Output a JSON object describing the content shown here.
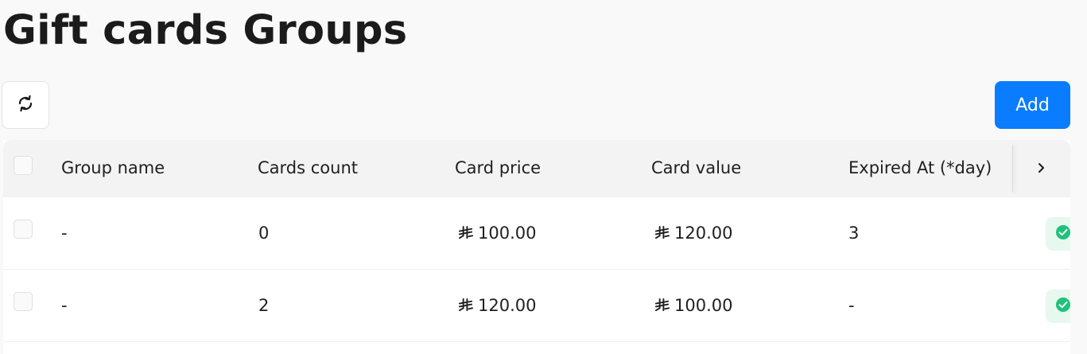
{
  "page": {
    "title": "Gift cards Groups"
  },
  "toolbar": {
    "refresh_icon": "refresh-icon",
    "add_label": "Add"
  },
  "table": {
    "columns": [
      "Group name",
      "Cards count",
      "Card price",
      "Card value",
      "Expired At (*day)"
    ],
    "rows": [
      {
        "group_name": "-",
        "cards_count": "0",
        "card_price": "100.00",
        "card_value": "120.00",
        "expired_at": "3",
        "status": "active"
      },
      {
        "group_name": "-",
        "cards_count": "2",
        "card_price": "120.00",
        "card_value": "100.00",
        "expired_at": "-",
        "status": "active"
      }
    ]
  },
  "colors": {
    "accent": "#0a7cff",
    "status_green": "#1ec27a"
  }
}
